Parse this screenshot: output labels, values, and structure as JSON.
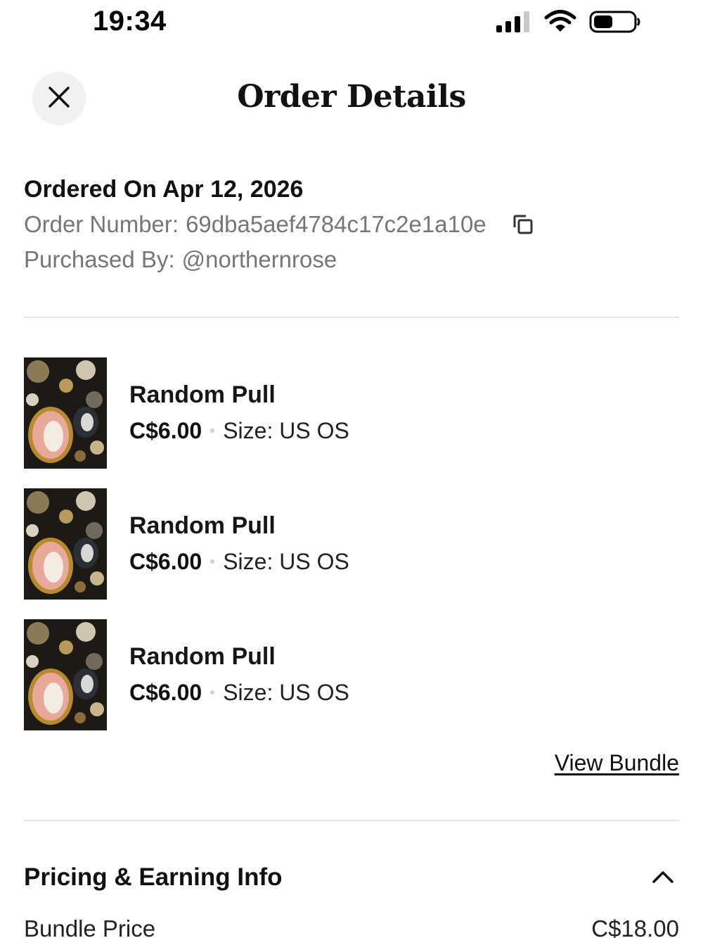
{
  "status_bar": {
    "time": "19:34",
    "icons": [
      "signal-icon",
      "wifi-icon",
      "battery-icon"
    ]
  },
  "header": {
    "title": "Order Details",
    "close_icon": "close-icon"
  },
  "order": {
    "ordered_on": "Ordered On Apr 12, 2026",
    "order_number_label": "Order Number:",
    "order_number": "69dba5aef4784c17c2e1a10e",
    "purchased_by_label": "Purchased By:",
    "purchased_by": "@northernrose"
  },
  "items": [
    {
      "title": "Random Pull",
      "price": "C$6.00",
      "size": "Size: US OS"
    },
    {
      "title": "Random Pull",
      "price": "C$6.00",
      "size": "Size: US OS"
    },
    {
      "title": "Random Pull",
      "price": "C$6.00",
      "size": "Size: US OS"
    }
  ],
  "view_bundle": "View Bundle",
  "pricing": {
    "title": "Pricing & Earning Info",
    "expanded": true,
    "rows": [
      {
        "label": "Bundle Price",
        "value": "C$18.00"
      }
    ]
  },
  "colors": {
    "text": "#111111",
    "muted": "#767676",
    "divider": "#e6e6e6",
    "close_bg": "#f1f1f1"
  }
}
